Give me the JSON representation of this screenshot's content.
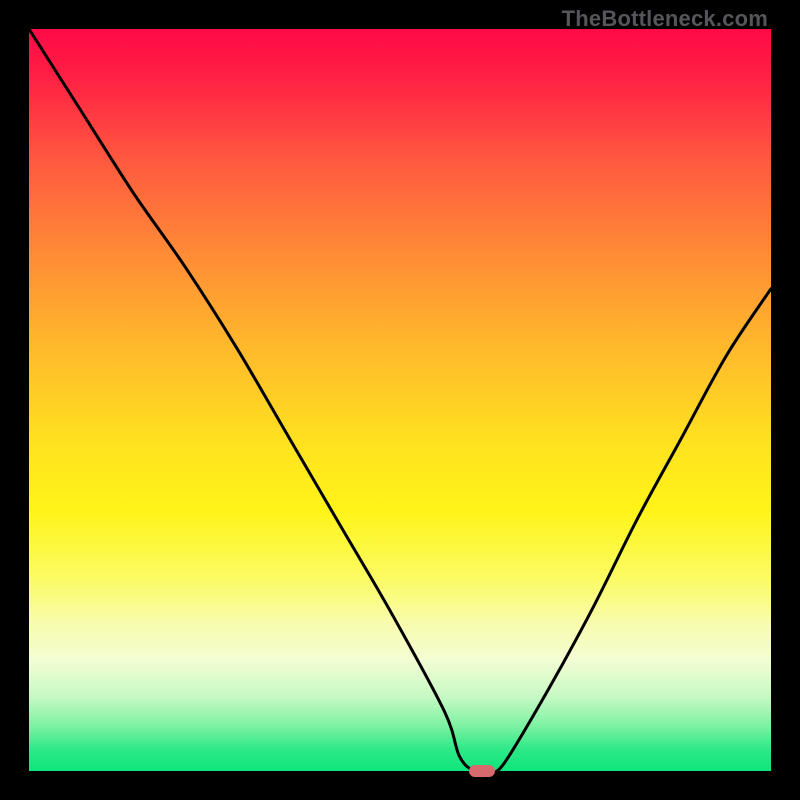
{
  "watermark": "TheBottleneck.com",
  "chart_data": {
    "type": "line",
    "title": "",
    "xlabel": "",
    "ylabel": "",
    "xlim": [
      0,
      100
    ],
    "ylim": [
      0,
      100
    ],
    "grid": false,
    "legend": false,
    "background": {
      "type": "vertical-gradient",
      "stops": [
        {
          "pos": 0,
          "color": "#ff0a46"
        },
        {
          "pos": 18,
          "color": "#ff5a3f"
        },
        {
          "pos": 42,
          "color": "#ffb62c"
        },
        {
          "pos": 65,
          "color": "#fff418"
        },
        {
          "pos": 85,
          "color": "#f3fdd3"
        },
        {
          "pos": 100,
          "color": "#0de57a"
        }
      ]
    },
    "series": [
      {
        "name": "bottleneck-curve",
        "color": "#000000",
        "x": [
          0,
          7,
          14,
          21,
          28,
          35,
          42,
          49,
          56,
          58,
          60,
          62,
          64,
          70,
          76,
          82,
          88,
          94,
          100
        ],
        "values": [
          100,
          89,
          78,
          68,
          57,
          45,
          33,
          21,
          8,
          2,
          0,
          0,
          1,
          11,
          22,
          34,
          45,
          56,
          65
        ]
      }
    ],
    "marker": {
      "x": 61,
      "y": 0,
      "color": "#d86a6e"
    }
  }
}
